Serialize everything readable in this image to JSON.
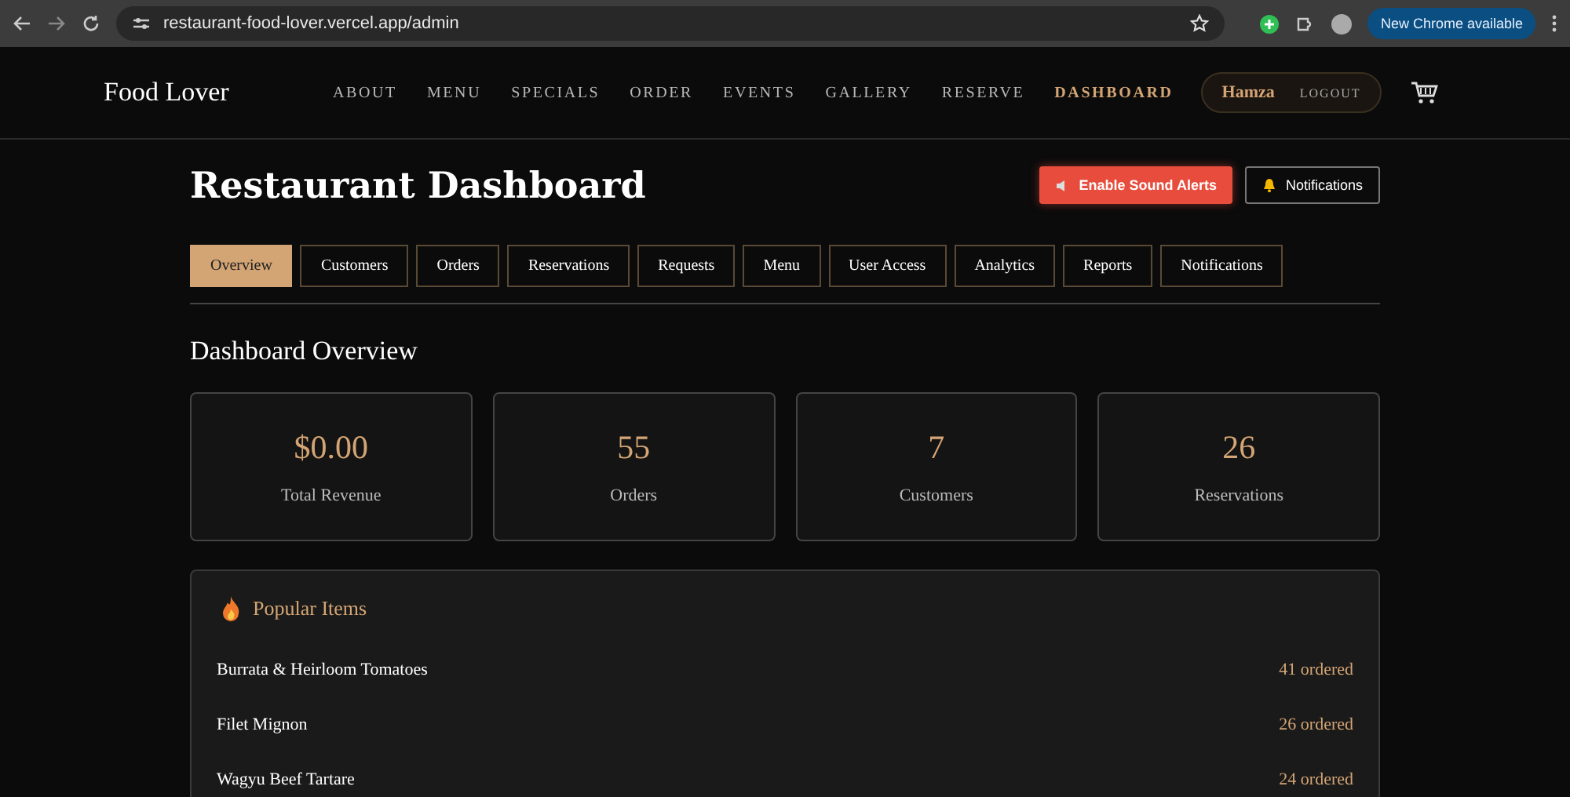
{
  "browser": {
    "url": "restaurant-food-lover.vercel.app/admin",
    "update_button": "New Chrome available"
  },
  "nav": {
    "brand": "Food Lover",
    "items": [
      {
        "label": "ABOUT",
        "selected": false
      },
      {
        "label": "MENU",
        "selected": false
      },
      {
        "label": "SPECIALS",
        "selected": false
      },
      {
        "label": "ORDER",
        "selected": false
      },
      {
        "label": "EVENTS",
        "selected": false
      },
      {
        "label": "GALLERY",
        "selected": false
      },
      {
        "label": "RESERVE",
        "selected": false
      },
      {
        "label": "DASHBOARD",
        "selected": true
      }
    ],
    "user": "Hamza",
    "logout": "LOGOUT"
  },
  "header": {
    "title": "Restaurant Dashboard",
    "sound_button": "Enable Sound Alerts",
    "notifications_button": "Notifications"
  },
  "tabs": [
    {
      "label": "Overview",
      "selected": true
    },
    {
      "label": "Customers",
      "selected": false
    },
    {
      "label": "Orders",
      "selected": false
    },
    {
      "label": "Reservations",
      "selected": false
    },
    {
      "label": "Requests",
      "selected": false
    },
    {
      "label": "Menu",
      "selected": false
    },
    {
      "label": "User Access",
      "selected": false
    },
    {
      "label": "Analytics",
      "selected": false
    },
    {
      "label": "Reports",
      "selected": false
    },
    {
      "label": "Notifications",
      "selected": false
    }
  ],
  "overview": {
    "title": "Dashboard Overview",
    "stats": [
      {
        "value": "$0.00",
        "label": "Total Revenue"
      },
      {
        "value": "55",
        "label": "Orders"
      },
      {
        "value": "7",
        "label": "Customers"
      },
      {
        "value": "26",
        "label": "Reservations"
      }
    ]
  },
  "popular": {
    "title": "Popular Items",
    "items": [
      {
        "name": "Burrata & Heirloom Tomatoes",
        "count": "41 ordered"
      },
      {
        "name": "Filet Mignon",
        "count": "26 ordered"
      },
      {
        "name": "Wagyu Beef Tartare",
        "count": "24 ordered"
      }
    ]
  }
}
